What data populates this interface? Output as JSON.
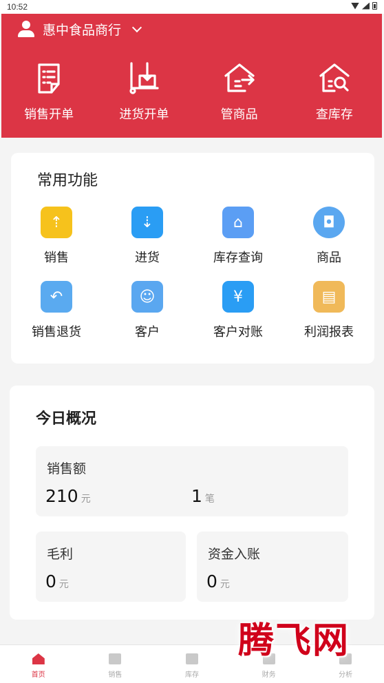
{
  "status_bar": {
    "time": "10:52"
  },
  "colors": {
    "brand": "#dc3545",
    "card": "#ffffff",
    "background": "#f4f4f4"
  },
  "header": {
    "store_name": "惠中食品商行",
    "quick_actions": [
      {
        "label": "销售开单",
        "icon": "receipt-icon"
      },
      {
        "label": "进货开单",
        "icon": "trolley-icon"
      },
      {
        "label": "管商品",
        "icon": "house-box-icon"
      },
      {
        "label": "查库存",
        "icon": "house-search-icon"
      }
    ]
  },
  "common": {
    "title": "常用功能",
    "items": [
      {
        "label": "销售",
        "icon": "sales-icon",
        "color": "#f6c21c"
      },
      {
        "label": "进货",
        "icon": "purchase-icon",
        "color": "#2a9df4"
      },
      {
        "label": "库存查询",
        "icon": "inventory-icon",
        "color": "#5b9ef4"
      },
      {
        "label": "商品",
        "icon": "goods-bag-icon",
        "color": "#5aa7f0"
      },
      {
        "label": "销售退货",
        "icon": "return-icon",
        "color": "#5aaaf0"
      },
      {
        "label": "客户",
        "icon": "customer-icon",
        "color": "#5aa7f0"
      },
      {
        "label": "客户对账",
        "icon": "reconcile-icon",
        "color": "#2a9df4"
      },
      {
        "label": "利润报表",
        "icon": "profit-report-icon",
        "color": "#f0b959"
      }
    ]
  },
  "today": {
    "title": "今日概况",
    "sales_label": "销售额",
    "sales_value": "210",
    "sales_unit": "元",
    "orders_value": "1",
    "orders_unit": "笔",
    "profit_label": "毛利",
    "profit_value": "0",
    "profit_unit": "元",
    "funds_label": "资金入账",
    "funds_value": "0",
    "funds_unit": "元"
  },
  "tabbar": [
    {
      "label": "首页",
      "icon": "home-icon",
      "active": true
    },
    {
      "label": "销售",
      "icon": "cart-icon",
      "active": false
    },
    {
      "label": "库存",
      "icon": "inventory-grid-icon",
      "active": false
    },
    {
      "label": "财务",
      "icon": "finance-icon",
      "active": false
    },
    {
      "label": "分析",
      "icon": "analysis-icon",
      "active": false
    }
  ],
  "watermark": {
    "text": "腾飞网"
  }
}
